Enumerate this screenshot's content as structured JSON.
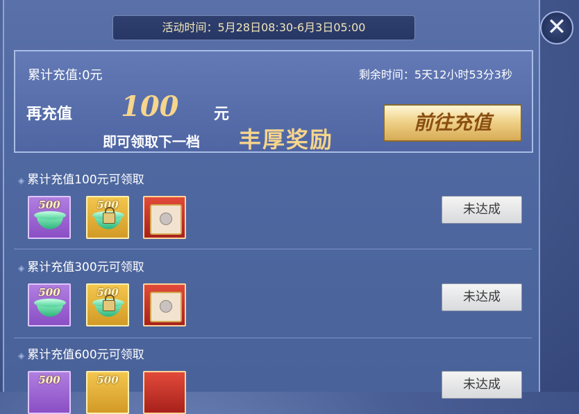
{
  "event_time": "活动时间：5月28日08:30-6月3日05:00",
  "close_symbol": "✕",
  "summary": {
    "total_recharge": "累计充值:0元",
    "remaining_time": "剩余时间：5天12小时53分3秒",
    "recharge_again": "再充值",
    "amount": "100",
    "unit": "元",
    "next_tier_text": "即可领取下一档",
    "rich_reward": "丰厚奖励",
    "recharge_button": "前往充值"
  },
  "tiers": [
    {
      "label": "累计充值100元可领取",
      "status": "未达成",
      "items": [
        {
          "type": "green-ingot",
          "quantity": "500",
          "frame": "purple"
        },
        {
          "type": "locked-green-ingot",
          "quantity": "500",
          "frame": "gold"
        },
        {
          "type": "scroll-chest",
          "frame": "red"
        }
      ]
    },
    {
      "label": "累计充值300元可领取",
      "status": "未达成",
      "items": [
        {
          "type": "green-ingot",
          "quantity": "500",
          "frame": "purple"
        },
        {
          "type": "locked-green-ingot",
          "quantity": "500",
          "frame": "gold"
        },
        {
          "type": "scroll-chest",
          "frame": "red"
        }
      ]
    },
    {
      "label": "累计充值600元可领取",
      "status": "未达成",
      "items": [
        {
          "type": "green-ingot",
          "quantity": "500",
          "frame": "purple"
        },
        {
          "type": "locked-green-ingot",
          "quantity": "500",
          "frame": "gold"
        },
        {
          "type": "scroll-chest",
          "frame": "red"
        }
      ]
    }
  ],
  "colors": {
    "gold_text": "#f6d58c",
    "panel_bg": "#5069a2",
    "time_text": "#f2e6b8"
  }
}
